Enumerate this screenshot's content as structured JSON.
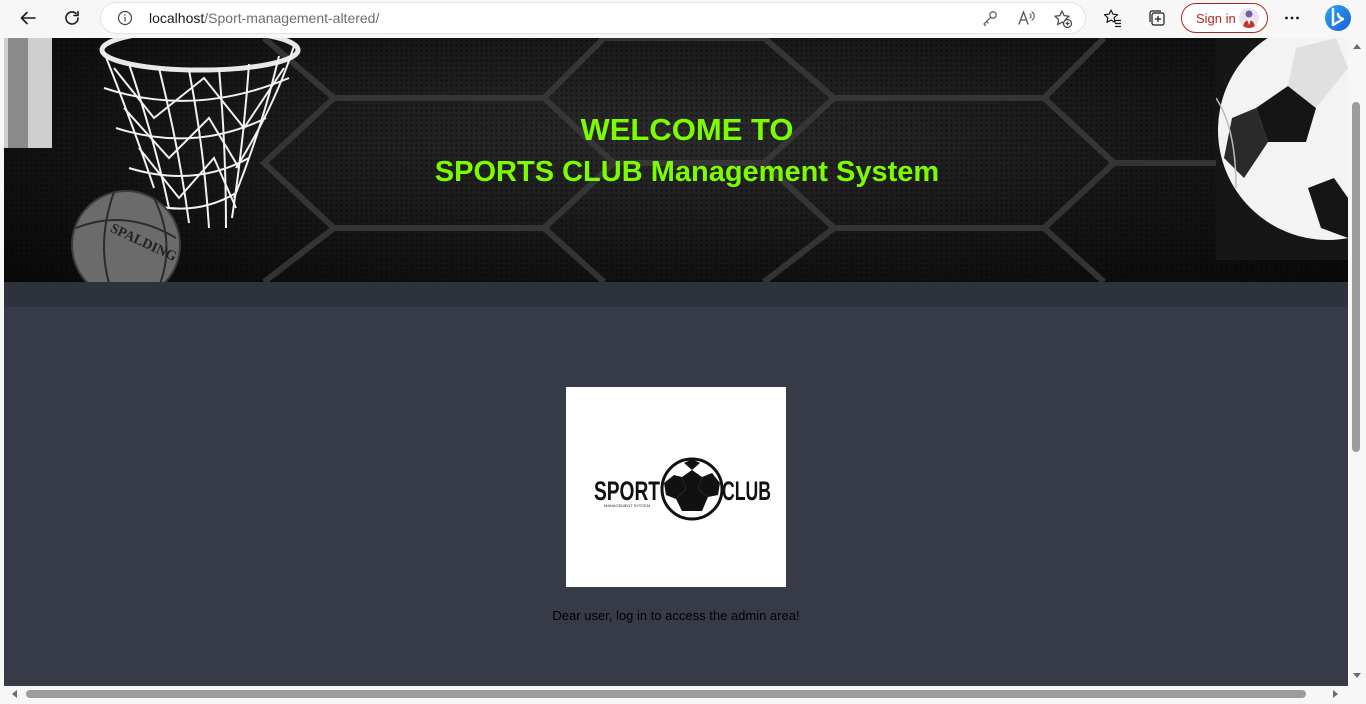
{
  "browser": {
    "url_host": "localhost",
    "url_path": "/Sport-management-altered/",
    "signin_label": "Sign in",
    "icons": [
      "back-icon",
      "refresh-icon",
      "site-info-icon",
      "key-icon",
      "read-aloud-icon",
      "add-favorite-icon",
      "favorites-icon",
      "collections-icon",
      "more-icon",
      "bing-icon"
    ]
  },
  "page": {
    "welcome_line1": "WELCOME TO",
    "welcome_line2": "SPORTS CLUB Management System",
    "login_message": "Dear user, log in to access the admin area!",
    "logo": {
      "word_left": "SPORT",
      "word_right": "CLUB",
      "tagline": "MANAGEMENT SYSTEM"
    },
    "colors": {
      "title": "#7cfc00",
      "background": "#363b47",
      "header_strip": "#2d323d"
    }
  }
}
